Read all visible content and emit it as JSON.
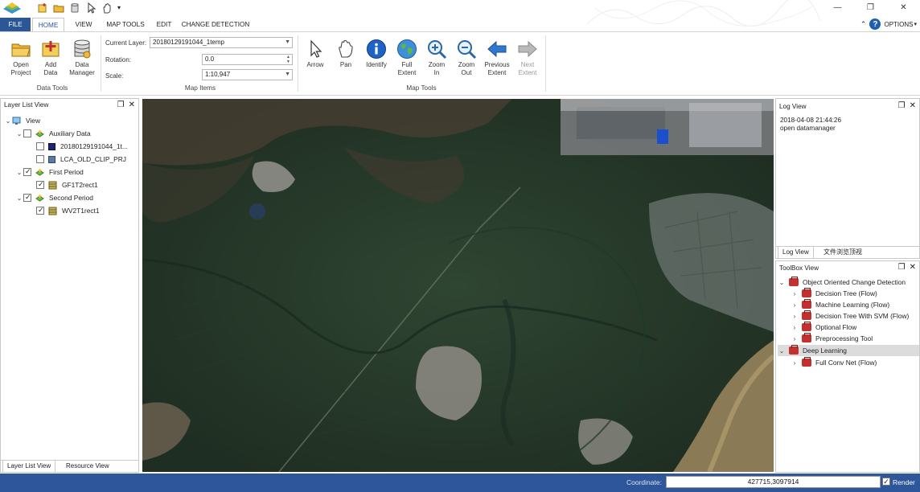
{
  "ribbon_tabs": {
    "file": "FILE",
    "home": "HOME",
    "view": "VIEW",
    "map_tools": "MAP TOOLS",
    "edit": "EDIT",
    "change_detection": "CHANGE DETECTION"
  },
  "options_label": "OPTIONS",
  "data_tools": {
    "group_label": "Data Tools",
    "open_project": [
      "Open",
      "Project"
    ],
    "add_data": [
      "Add",
      "Data"
    ],
    "data_manager": [
      "Data",
      "Manager"
    ]
  },
  "map_items": {
    "group_label": "Map Items",
    "current_layer_label": "Current Layer:",
    "current_layer_value": "20180129191044_1temp",
    "rotation_label": "Rotation:",
    "rotation_value": "0.0",
    "scale_label": "Scale:",
    "scale_value": "1:10,947"
  },
  "map_tools": {
    "group_label": "Map Tools",
    "arrow": [
      "Arrow",
      ""
    ],
    "pan": [
      "Pan",
      ""
    ],
    "identify": [
      "Identify",
      ""
    ],
    "full_extent": [
      "Full",
      "Extent"
    ],
    "zoom_in": [
      "Zoom",
      "In"
    ],
    "zoom_out": [
      "Zoom",
      "Out"
    ],
    "previous_extent": [
      "Previous",
      "Extent"
    ],
    "next_extent": [
      "Next",
      "Extent"
    ]
  },
  "layer_list": {
    "title": "Layer List View",
    "items": {
      "view": "View",
      "auxiliary": "Auxiliary Data",
      "aux_1": "20180129191044_1t...",
      "aux_2": "LCA_OLD_CLIP_PRJ",
      "first_period": "First Period",
      "first_1": "GF1T2rect1",
      "second_period": "Second Period",
      "second_1": "WV2T1rect1"
    },
    "tabs": {
      "layer_list": "Layer List View",
      "resource": "Resource View"
    }
  },
  "log_view": {
    "title": "Log View",
    "timestamp": "2018-04-08 21:44:26",
    "message": "open datamanager",
    "tabs": {
      "log": "Log View",
      "files": "文件浏览顶视"
    }
  },
  "toolbox": {
    "title": "ToolBox View",
    "ocd": "Object Oriented Change Detection",
    "decision_tree": "Decision Tree (Flow)",
    "machine_learning": "Machine Learning (Flow)",
    "dt_svm": "Decision Tree With SVM (Flow)",
    "optional": "Optional Flow",
    "preprocessing": "Preprocessing Tool",
    "deep_learning": "Deep Learning",
    "fcn": "Full Conv Net (Flow)"
  },
  "status": {
    "coordinate_label": "Coordinate:",
    "coordinate_value": "427715,3097914",
    "render_label": "Render"
  },
  "colors": {
    "accent": "#2b5797",
    "status_bar": "#2d579a",
    "toolbox_icon": "#c2312f"
  }
}
